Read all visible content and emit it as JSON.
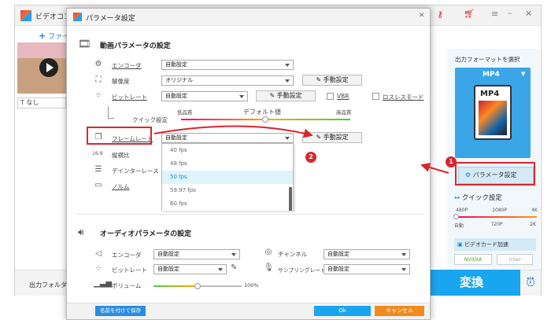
{
  "bg_app": {
    "title": "ビデオコン",
    "add_file": "ファイ",
    "subtitle": "なし",
    "output_folder": "出力フォルダ",
    "format_header": "出力フォーマットを選択",
    "format": "MP4",
    "param_button": "パラメータ設定",
    "quick_settings": "クイック設定",
    "quick_top": [
      "480P",
      "1080P",
      "4K"
    ],
    "quick_bottom": [
      "自動",
      "720P",
      "2K"
    ],
    "gpu_label": "ビデオカード加速",
    "nvidia": "NVIDIA",
    "intel": "Intel",
    "convert": "変換"
  },
  "dialog": {
    "title": "パラメータ設定",
    "video_section": "動画パラメータの設定",
    "encoder_label": "エンコーダ",
    "encoder_value": "自動設定",
    "resolution_label": "解像度",
    "resolution_value": "オリジナル",
    "manual": "手動設定",
    "bitrate_label": "ビットレート",
    "bitrate_value": "自動設定",
    "vbr": "VBR",
    "lossless": "ロスレスモード",
    "quick_label": "クイック設定",
    "low": "低品質",
    "default_value": "デフォルト値",
    "high": "高品質",
    "framerate_label": "フレームレート",
    "framerate_value": "自動設定",
    "aspect_label": "縦横比",
    "deinterlace_label": "デインターレース",
    "normal_label": "ノルム",
    "fps_options": [
      "40 fps",
      "48 fps",
      "50 fps",
      "59.97 fps",
      "60 fps"
    ],
    "audio_section": "オーディオパラメータの設定",
    "a_encoder_label": "エンコーダ",
    "a_encoder_value": "自動設定",
    "channel_label": "チャンネル",
    "channel_value": "自動設定",
    "a_bitrate_label": "ビットレート",
    "a_bitrate_value": "自動設定",
    "samplerate_label": "サンプリングレート",
    "samplerate_value": "自動設定",
    "volume_label": "ボリューム",
    "volume_value": "100%",
    "save_as": "名前を付けて保存",
    "ok": "Ok",
    "cancel": "キャンセル"
  },
  "annotations": {
    "one": "1",
    "two": "2"
  },
  "colors": {
    "accent": "#1a9ee6",
    "convert": "#1aa5f0",
    "cancel": "#f08a1c",
    "annotation": "#d9262b",
    "selected": "#dff3fb"
  }
}
